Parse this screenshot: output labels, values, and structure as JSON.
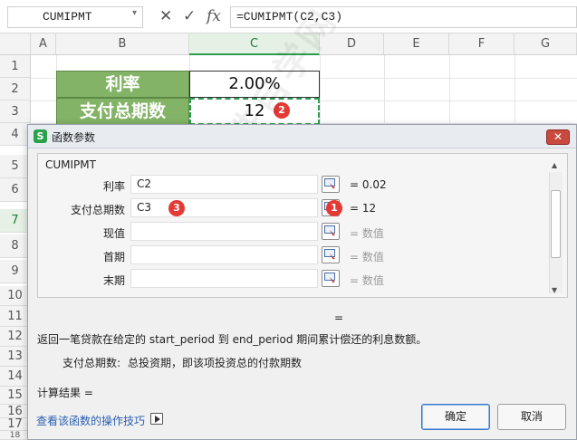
{
  "formula_bar": {
    "name_box": "CUMIPMT",
    "cancel_icon": "✕",
    "confirm_icon": "✓",
    "fx_label": "fx",
    "formula": "=CUMIPMT(C2,C3)"
  },
  "grid": {
    "columns": [
      "A",
      "B",
      "C",
      "D",
      "E",
      "F",
      "G"
    ],
    "rows": [
      "1",
      "2",
      "3",
      "4",
      "5",
      "6",
      "7",
      "8",
      "9",
      "10",
      "11",
      "12",
      "13",
      "14",
      "15",
      "16",
      "17",
      "18"
    ],
    "cells": {
      "b2": "利率",
      "c2": "2.00%",
      "b3": "支付总期数",
      "c3": "12"
    },
    "badge_c3": "2"
  },
  "dialog": {
    "logo": "S",
    "title": "函数参数",
    "close_label": "✕",
    "function_name": "CUMIPMT",
    "args": [
      {
        "label": "利率",
        "value": "C2",
        "result": "= 0.02"
      },
      {
        "label": "支付总期数",
        "value": "C3",
        "result": "= 12"
      },
      {
        "label": "现值",
        "value": "",
        "result": "= 数值"
      },
      {
        "label": "首期",
        "value": "",
        "result": "= 数值"
      },
      {
        "label": "末期",
        "value": "",
        "result": "= 数值"
      }
    ],
    "badge_arg_input": "3",
    "badge_arg_button": "1",
    "overall_result": "=",
    "description": "返回一笔贷款在给定的 start_period 到 end_period 期间累计偿还的利息数额。",
    "param_help_label": "支付总期数:",
    "param_help_text": "总投资期，即该项投资总的付款期数",
    "calc_result_label": "计算结果 =",
    "tips_link": "查看该函数的操作技巧",
    "ok_label": "确定",
    "cancel_label": "取消"
  },
  "watermark": "软件自学网"
}
